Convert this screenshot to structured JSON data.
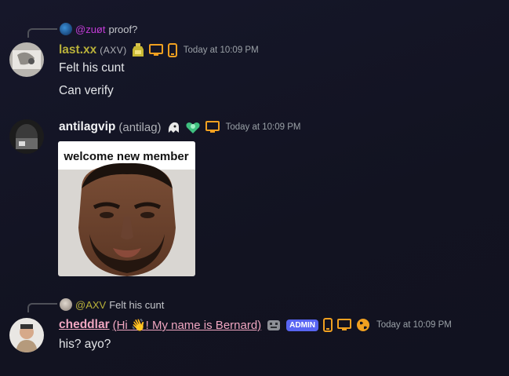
{
  "colors": {
    "background": "#131422",
    "username_lastxx": "#b8b03a",
    "username_default": "#f2f3f5",
    "username_cheddlar": "#f0a6c1",
    "mention": "#c23bd6",
    "admin_badge": "#5865f2",
    "device_icon": "#f0a020"
  },
  "messages": [
    {
      "reply": {
        "mention": "@zuøt",
        "text": "proof?"
      },
      "username": "last.xx",
      "tag": "(AXV)",
      "icons": [
        "potion-badge-icon",
        "desktop-icon",
        "mobile-icon"
      ],
      "timestamp": "Today at 10:09 PM",
      "lines": [
        "Felt his cunt",
        "Can verify"
      ]
    },
    {
      "username": "antilagvip",
      "tag": "(antilag)",
      "icons": [
        "ghost-badge-icon",
        "green-heart-badge-icon",
        "desktop-icon"
      ],
      "timestamp": "Today at 10:09 PM",
      "attachment": {
        "caption": "welcome new member"
      }
    },
    {
      "reply": {
        "mention": "@AXV",
        "text": "Felt his cunt"
      },
      "username": "cheddlar",
      "tag_before": "(Hi ",
      "tag_emoji": "👋",
      "tag_after": "! My name is Bernard)",
      "badge": "ADMIN",
      "icons": [
        "robot-badge-icon",
        "mobile-icon",
        "desktop-icon",
        "globe-icon"
      ],
      "timestamp": "Today at 10:09 PM",
      "lines": [
        "his? ayo?"
      ]
    }
  ]
}
